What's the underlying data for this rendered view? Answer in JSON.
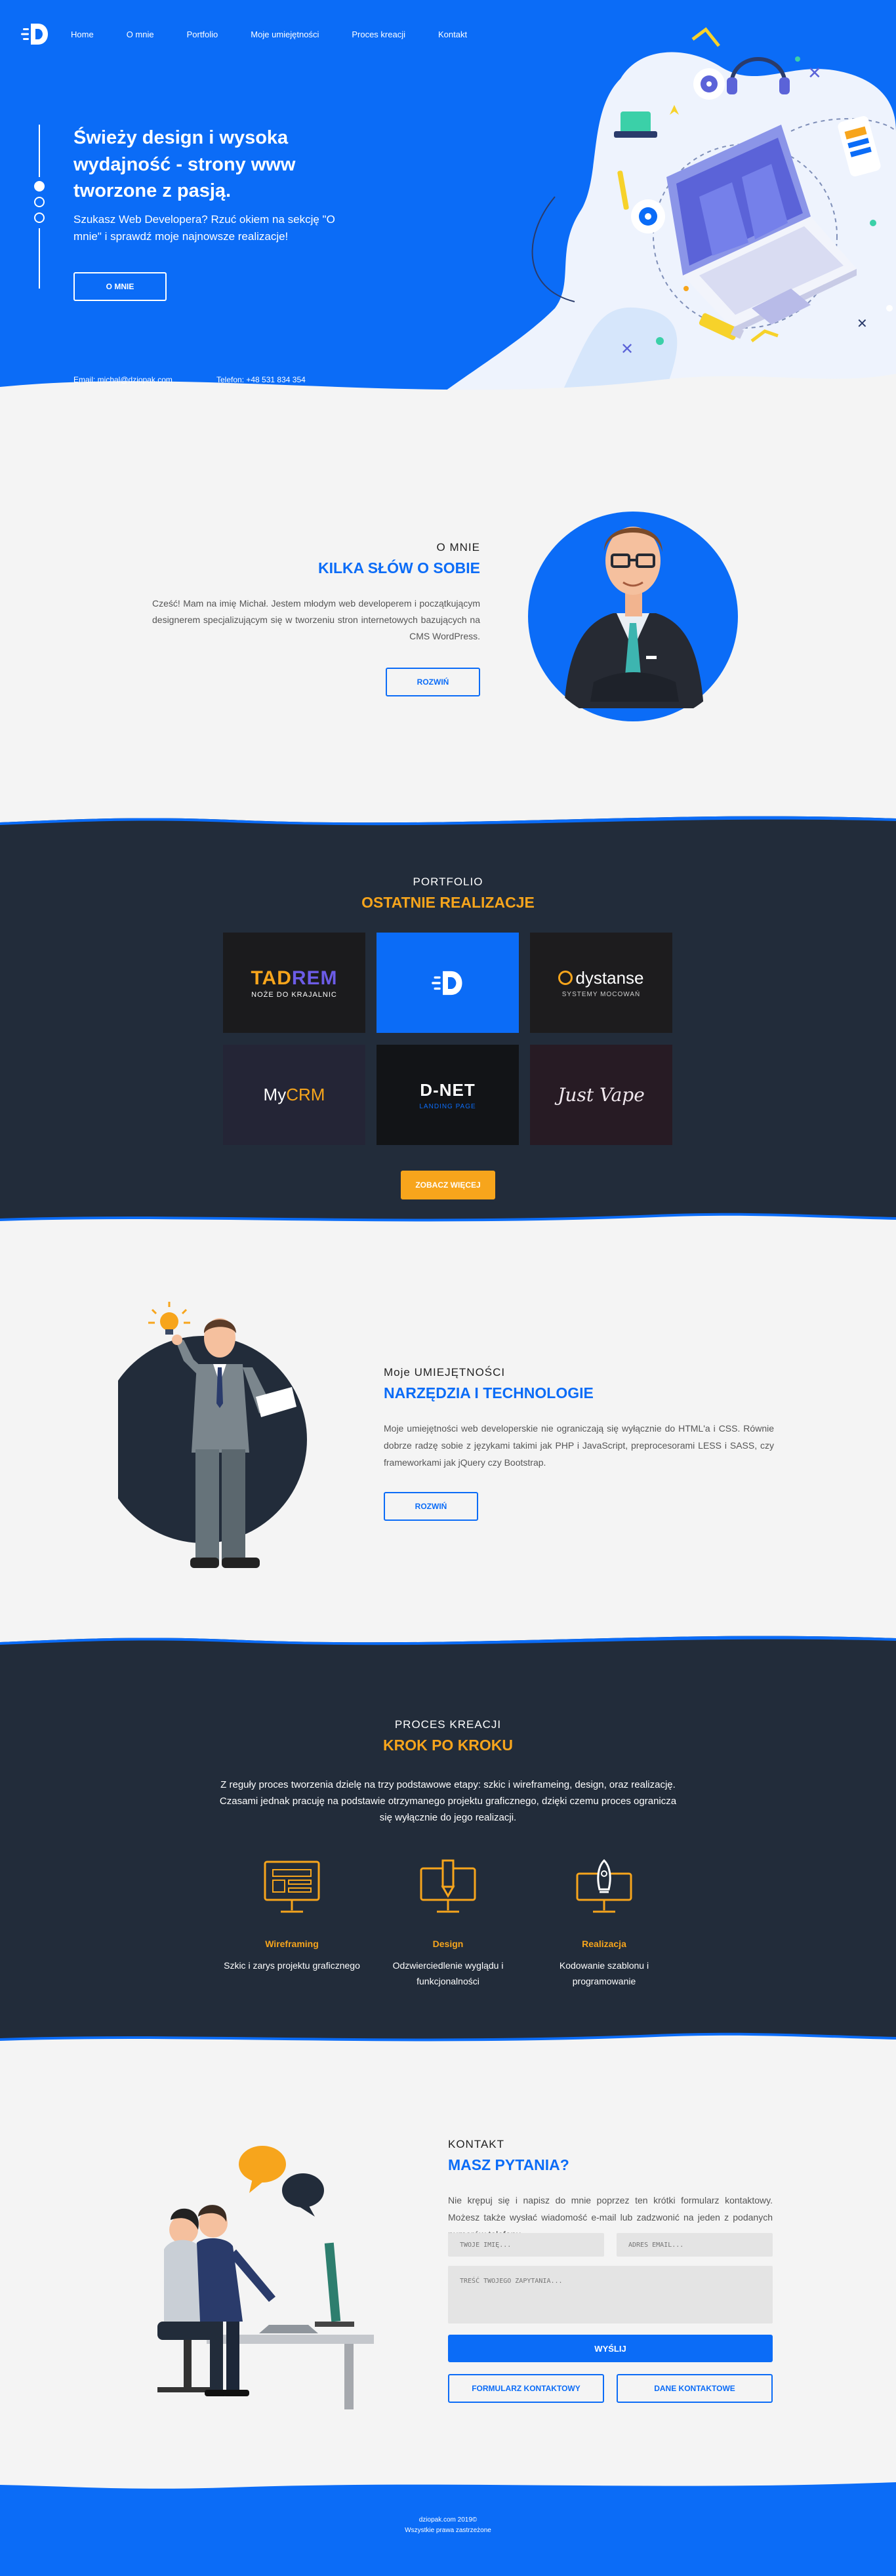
{
  "nav": {
    "items": [
      "Home",
      "O mnie",
      "Portfolio",
      "Moje umiejętności",
      "Proces kreacji",
      "Kontakt"
    ]
  },
  "hero": {
    "title": "Świeży design i wysoka wydajność - strony www tworzone z pasją.",
    "subtitle": "Szukasz Web Developera? Rzuć okiem na sekcję \"O mnie\" i sprawdź moje najnowsze realizacje!",
    "button": "O MNIE",
    "email": "Email: michal@dziopak.com",
    "phone": "Telefon: +48 531 834 354"
  },
  "about": {
    "kicker": "O MNIE",
    "heading": "KILKA SŁÓW O SOBIE",
    "text": "Cześć! Mam na imię Michał. Jestem młodym web developerem i początkującym designerem specjalizującym się w tworzeniu stron internetowych bazujących na CMS WordPress.",
    "button": "ROZWIŃ"
  },
  "portfolio": {
    "kicker": "PORTFOLIO",
    "heading": "OSTATNIE REALIZACJE",
    "tiles": [
      {
        "name": "tadrem",
        "line1a": "TAD",
        "line1b": "REM",
        "line2": "NOŻE DO KRAJALNIC",
        "bg": "#1b1b1d"
      },
      {
        "name": "dziopak",
        "bg": "#0b6cf7"
      },
      {
        "name": "dystanse",
        "line1": "dystanse",
        "line2": "SYSTEMY MOCOWAŃ",
        "bg": "#1d1c1e"
      },
      {
        "name": "mycrm",
        "line1a": "My",
        "line1b": "CRM",
        "bg": "#242536"
      },
      {
        "name": "dnet",
        "line1": "D-NET",
        "line2": "LANDING PAGE",
        "bg": "#121417"
      },
      {
        "name": "justvape",
        "line1": "Just Vape",
        "bg": "#271b24"
      }
    ],
    "button": "ZOBACZ WIĘCEJ"
  },
  "skills": {
    "kicker": "Moje UMIEJĘTNOŚCI",
    "heading": "NARZĘDZIA I TECHNOLOGIE",
    "text": "Moje umiejętności web developerskie nie ograniczają się wyłącznie do HTML'a i CSS. Równie dobrze radzę sobie z językami takimi jak PHP i JavaScript, preprocesorami LESS i SASS, czy frameworkami jak jQuery czy Bootstrap.",
    "button": "ROZWIŃ"
  },
  "process": {
    "kicker": "PROCES KREACJI",
    "heading": "KROK PO KROKU",
    "text": "Z reguły proces tworzenia dzielę na trzy podstawowe etapy: szkic i wireframeing, design, oraz realizację. Czasami jednak pracuję na podstawie otrzymanego projektu graficznego, dzięki czemu proces ogranicza się wyłącznie do jego realizacji.",
    "steps": [
      {
        "title": "Wireframing",
        "desc": "Szkic i zarys projektu graficznego"
      },
      {
        "title": "Design",
        "desc": "Odzwierciedlenie wyglądu i funkcjonalności"
      },
      {
        "title": "Realizacja",
        "desc": "Kodowanie szablonu i programowanie"
      }
    ]
  },
  "contact": {
    "kicker": "KONTAKT",
    "heading": "MASZ PYTANIA?",
    "text": "Nie krępuj się i napisz do mnie poprzez ten krótki formularz kontaktowy. Możesz także wysłać wiadomość e-mail lub zadzwonić na jeden z podanych numerów telefonu.",
    "name_placeholder": "TWOJE IMIĘ...",
    "email_placeholder": "ADRES EMAIL...",
    "message_placeholder": "TREŚĆ TWOJEGO ZAPYTANIA...",
    "send": "WYŚLIJ",
    "form_button": "FORMULARZ KONTAKTOWY",
    "data_button": "DANE KONTAKTOWE"
  },
  "footer": {
    "line1": "dziopak.com 2019©",
    "line2": "Wszystkie prawa zastrzeżone"
  },
  "colors": {
    "primary": "#0b6cf7",
    "dark": "#222c3a",
    "accent": "#f7a51c",
    "light": "#f4f4f4"
  }
}
